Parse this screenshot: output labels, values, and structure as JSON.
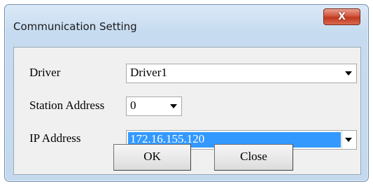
{
  "window": {
    "title": "Communication Setting",
    "close_glyph": "X"
  },
  "form": {
    "driver_label": "Driver",
    "driver_value": "Driver1",
    "station_label": "Station Address",
    "station_value": "0",
    "ip_label": "IP Address",
    "ip_value": "172.16.155.120"
  },
  "buttons": {
    "ok_label": "OK",
    "close_label": "Close"
  },
  "icons": {
    "close": "close-icon",
    "dropdown": "chevron-down-icon"
  },
  "colors": {
    "title_bar": "#c6dbf0",
    "close_button": "#c8452b",
    "selection": "#3399ff"
  }
}
